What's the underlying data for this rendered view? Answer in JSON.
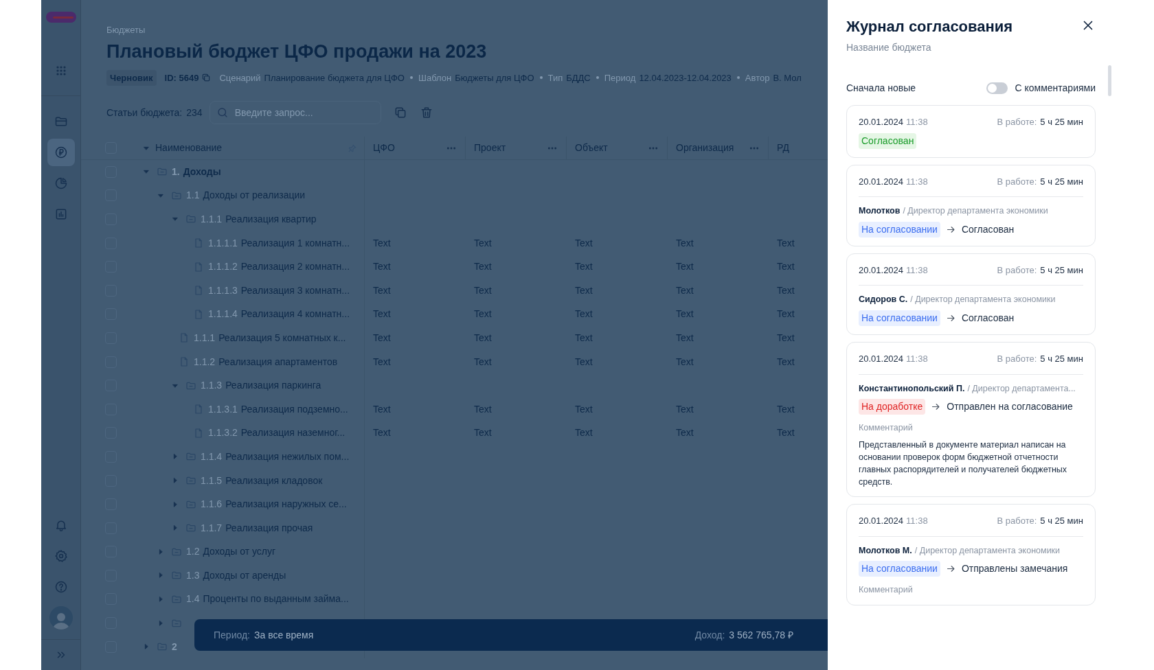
{
  "sidebar": {
    "nav_items": [
      {
        "selected": false
      },
      {
        "selected": false
      },
      {
        "selected": true
      },
      {
        "selected": false
      },
      {
        "selected": false
      }
    ],
    "bottom_items": [
      {
        "selected": false
      },
      {
        "selected": false
      },
      {
        "selected": false
      }
    ]
  },
  "breadcrumb": "Бюджеты",
  "title": "Плановый бюджет ЦФО продажи на 2023",
  "meta": {
    "status": "Черновик",
    "id": "ID: 5649",
    "fields": [
      {
        "label": "Сценарий",
        "value": "Планирование бюджета для ЦФО"
      },
      {
        "label": "Шаблон",
        "value": "Бюджеты для ЦФО"
      },
      {
        "label": "Тип",
        "value": "БДДС"
      },
      {
        "label": "Период",
        "value": "12.04.2023-12.04.2023"
      },
      {
        "label": "Автор",
        "value": "В. Мол"
      }
    ]
  },
  "toolbar": {
    "label": "Статьи бюджета:",
    "count": "234",
    "search_placeholder": "Введите запрос..."
  },
  "table": {
    "columns": [
      "Наименование",
      "ЦФО",
      "Проект",
      "Объект",
      "Организация",
      "РД"
    ],
    "all_checked": false,
    "rows": [
      {
        "kind": "folder",
        "checked": false,
        "number": "1.",
        "name": "Доходы",
        "expanded": true,
        "children": [
          {
            "kind": "folder",
            "checked": false,
            "number": "1.1",
            "name": "Доходы от реализации",
            "expanded": true,
            "children": [
              {
                "kind": "folder",
                "checked": false,
                "number": "1.1.1",
                "name": "Реализация квартир",
                "expanded": true,
                "children": [
                  {
                    "kind": "file",
                    "checked": false,
                    "number": "1.1.1.1",
                    "name": "Реализация 1 комнатн...",
                    "cells": [
                      "Text",
                      "Text",
                      "Text",
                      "Text",
                      "Text"
                    ]
                  },
                  {
                    "kind": "file",
                    "checked": false,
                    "number": "1.1.1.2",
                    "name": "Реализация 2 комнатн...",
                    "cells": [
                      "Text",
                      "Text",
                      "Text",
                      "Text",
                      "Text"
                    ]
                  },
                  {
                    "kind": "file",
                    "checked": false,
                    "number": "1.1.1.3",
                    "name": "Реализация 3 комнатн...",
                    "cells": [
                      "Text",
                      "Text",
                      "Text",
                      "Text",
                      "Text"
                    ]
                  },
                  {
                    "kind": "file",
                    "checked": false,
                    "number": "1.1.1.4",
                    "name": "Реализация 4 комнатн...",
                    "cells": [
                      "Text",
                      "Text",
                      "Text",
                      "Text",
                      "Text"
                    ]
                  }
                ]
              },
              {
                "kind": "file",
                "checked": false,
                "number": "1.1.1",
                "name": "Реализация 5 комнатных к...",
                "cells": [
                  "Text",
                  "Text",
                  "Text",
                  "Text",
                  "Text"
                ]
              },
              {
                "kind": "file",
                "checked": false,
                "number": "1.1.2",
                "name": "Реализация апартаментов",
                "cells": [
                  "Text",
                  "Text",
                  "Text",
                  "Text",
                  "Text"
                ]
              },
              {
                "kind": "folder",
                "checked": false,
                "number": "1.1.3",
                "name": "Реализация паркинга",
                "expanded": true,
                "children": [
                  {
                    "kind": "file",
                    "checked": false,
                    "number": "1.1.3.1",
                    "name": "Реализация подземно...",
                    "cells": [
                      "Text",
                      "Text",
                      "Text",
                      "Text",
                      "Text"
                    ]
                  },
                  {
                    "kind": "file",
                    "checked": false,
                    "number": "1.1.3.2",
                    "name": "Реализация наземног...",
                    "cells": [
                      "Text",
                      "Text",
                      "Text",
                      "Text",
                      "Text"
                    ]
                  }
                ]
              },
              {
                "kind": "folder",
                "checked": false,
                "number": "1.1.4",
                "name": "Реализация нежилых пом...",
                "expanded": false
              },
              {
                "kind": "folder",
                "checked": false,
                "number": "1.1.5",
                "name": "Реализация кладовок",
                "expanded": false
              },
              {
                "kind": "folder",
                "checked": false,
                "number": "1.1.6",
                "name": "Реализация наружных се...",
                "expanded": false
              },
              {
                "kind": "folder",
                "checked": false,
                "number": "1.1.7",
                "name": "Реализация прочая",
                "expanded": false
              }
            ]
          },
          {
            "kind": "folder",
            "checked": false,
            "number": "1.2",
            "name": "Доходы от услуг",
            "expanded": false
          },
          {
            "kind": "folder",
            "checked": false,
            "number": "1.3",
            "name": "Доходы от аренды",
            "expanded": false
          },
          {
            "kind": "folder",
            "checked": false,
            "number": "1.4",
            "name": "Проценты по выданным займа...",
            "expanded": false
          },
          {
            "kind": "folder",
            "checked": false,
            "expanded": false
          }
        ]
      },
      {
        "kind": "folder",
        "checked": false,
        "number": "2",
        "expanded": false
      }
    ]
  },
  "footer_bar": {
    "items": [
      {
        "label": "Период:",
        "value": "За все время"
      },
      {
        "label": "Доход:",
        "value": "3 562 765,78 ₽"
      }
    ]
  },
  "panel": {
    "title": "Журнал согласования",
    "subtitle": "Название бюджета",
    "sort_label": "Сначала новые",
    "toggle": {
      "label": "С комментариями",
      "on": false
    },
    "entries": [
      {
        "date": "20.01.2024",
        "time": "11:38",
        "work_label": "В работе:",
        "work_value": "5 ч 25 мин",
        "status": {
          "text": "Согласован",
          "kind": "approved"
        }
      },
      {
        "date": "20.01.2024",
        "time": "11:38",
        "work_label": "В работе:",
        "work_value": "5 ч 25 мин",
        "person": "Молотков",
        "role": "/ Директор департамента экономики",
        "status": {
          "text": "На согласовании",
          "kind": "review"
        },
        "result": "Согласован"
      },
      {
        "date": "20.01.2024",
        "time": "11:38",
        "work_label": "В работе:",
        "work_value": "5 ч 25 мин",
        "person": "Сидоров С.",
        "role": "/ Директор департамента экономики",
        "status": {
          "text": "На согласовании",
          "kind": "review"
        },
        "result": "Согласован"
      },
      {
        "date": "20.01.2024",
        "time": "11:38",
        "work_label": "В работе:",
        "work_value": "5 ч 25 мин",
        "person": "Константинопольский П.",
        "role": "/ Директор департамента...",
        "status": {
          "text": "На доработке",
          "kind": "rework"
        },
        "result": "Отправлен на согласование",
        "comment_label": "Комментарий",
        "comment": "Представленный  в документе материал написан на основании проверок форм бюджетной отчетности главных распорядителей и получателей бюджетных средств."
      },
      {
        "date": "20.01.2024",
        "time": "11:38",
        "work_label": "В работе:",
        "work_value": "5 ч 25 мин",
        "person": "Молотков М.",
        "role": "/ Директор департамента экономики",
        "status": {
          "text": "На согласовании",
          "kind": "review"
        },
        "result": "Отправлены замечания",
        "comment_label": "Комментарий"
      }
    ]
  }
}
